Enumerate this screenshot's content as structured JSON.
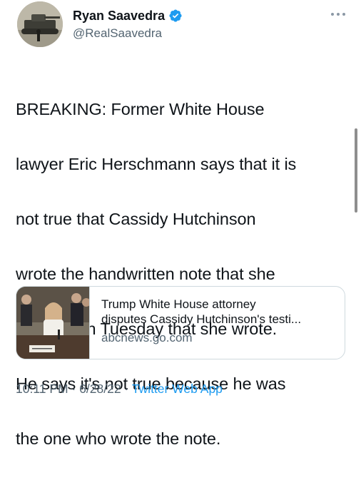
{
  "author": {
    "display_name": "Ryan Saavedra",
    "handle": "@RealSaavedra",
    "verified": true,
    "avatar_icon": "tank-photo-avatar"
  },
  "tweet": {
    "text_lines": [
      "BREAKING: Former White House",
      "lawyer Eric Herschmann says that it is",
      "not true that Cassidy Hutchinson",
      "wrote the handwritten note that she",
      "testified on Tuesday that she wrote.",
      "He says it's not true because he was",
      "the one who wrote the note."
    ]
  },
  "link_card": {
    "title_line_1": "Trump White House attorney",
    "title_line_2": "disputes Cassidy Hutchinson's testi...",
    "domain": "abcnews.go.com",
    "thumbnail_icon": "hearing-photo-thumbnail"
  },
  "meta": {
    "time": "10:11 PM",
    "separator_1": " · ",
    "date": "6/28/22",
    "separator_2": " · ",
    "source": "Twitter Web App"
  },
  "icons": {
    "more": "more-options-icon",
    "verified": "verified-badge-icon"
  },
  "colors": {
    "accent": "#1d9bf0",
    "secondary_text": "#536471",
    "primary_text": "#0f1419",
    "border": "#cfd9de"
  }
}
